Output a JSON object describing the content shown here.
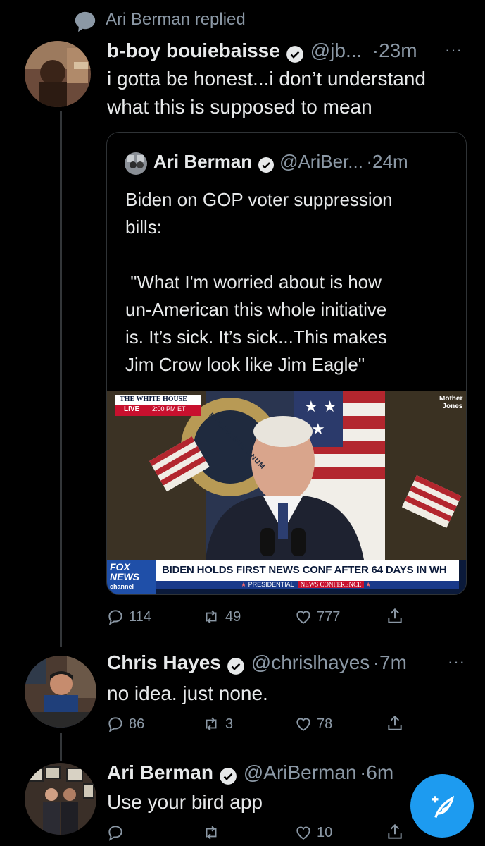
{
  "context": {
    "replied_text": "Ari Berman replied"
  },
  "tweet1": {
    "name": "b-boy bouiebaisse",
    "handle": "@jb...",
    "time": "·23m",
    "text_line1": "i gotta be honest...i don’t understand",
    "text_line2": "what this is supposed to mean"
  },
  "quoted": {
    "name": "Ari Berman",
    "handle": "@AriBer...",
    "time": "·24m",
    "lines": [
      "Biden on GOP voter suppression",
      "bills:",
      " \"What I'm worried about is how",
      "un-American this whole initiative",
      "is. It’s sick. It’s sick...This makes",
      "Jim Crow look like Jim Eagle\""
    ],
    "media": {
      "live_top": "THE WHITE HOUSE",
      "live_word": "LIVE",
      "live_time": "2:00 PM ET",
      "seal_text": "E PLURIBUS UNUM",
      "watermark_1": "Mother",
      "watermark_2": "Jones",
      "fox_1": "FOX",
      "fox_2": "NEWS",
      "fox_3": "channel",
      "headline": "BIDEN HOLDS FIRST NEWS CONF AFTER 64 DAYS IN WH",
      "subline_1": "PRESIDENTIAL",
      "subline_2": "NEWS CONFERENCE"
    }
  },
  "tweet1_actions": {
    "replies": "114",
    "retweets": "49",
    "likes": "777"
  },
  "tweet2": {
    "name": "Chris Hayes",
    "handle": "@chrislhayes",
    "time": "·7m",
    "text": "no idea. just none.",
    "replies": "86",
    "retweets": "3",
    "likes": "78"
  },
  "tweet3": {
    "name": "Ari Berman",
    "handle": "@AriBerman",
    "time": "·6m",
    "text": "Use your bird app",
    "likes": "10"
  },
  "more_label": "···",
  "icons": [
    "speech-bubble-icon",
    "verified-badge-icon",
    "reply-icon",
    "retweet-icon",
    "like-icon",
    "share-icon",
    "compose-tweet-icon"
  ],
  "colors": {
    "background": "#000000",
    "verified": "#e7e9ea",
    "accent": "#1d9bf0",
    "secondary_text": "#8b98a5"
  }
}
